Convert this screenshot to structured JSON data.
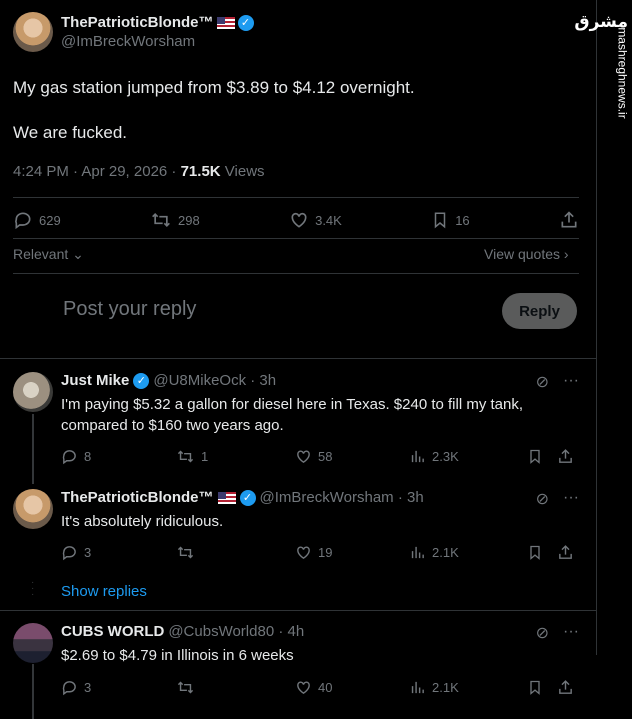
{
  "post": {
    "author_name": "ThePatrioticBlonde™",
    "author_handle": "@ImBreckWorsham",
    "text_line1": "My gas station jumped from $3.89 to $4.12 overnight.",
    "text_line2": "We are fucked.",
    "time": "4:24 PM · Apr 29, 2026 · ",
    "views_count": "71.5K",
    "views_label": " Views",
    "replies": "629",
    "reposts": "298",
    "likes": "3.4K",
    "bookmarks": "16"
  },
  "sort": {
    "label": "Relevant",
    "view_quotes": "View quotes"
  },
  "composer": {
    "placeholder": "Post your reply",
    "button": "Reply"
  },
  "replies": [
    {
      "name": "Just Mike",
      "handle": "@U8MikeOck · 3h",
      "text": "I'm paying $5.32 a gallon for diesel here in Texas. $240 to fill my tank, compared to $160 two years ago.",
      "replies": "8",
      "reposts": "1",
      "likes": "58",
      "views": "2.3K"
    },
    {
      "name": "ThePatrioticBlonde™",
      "handle": "@ImBreckWorsham · 3h",
      "text": "It's absolutely ridiculous.",
      "replies": "3",
      "reposts": "",
      "likes": "19",
      "views": "2.1K"
    },
    {
      "name": "CUBS WORLD",
      "handle": "@CubsWorld80 · 4h",
      "text": "$2.69 to $4.79 in Illinois in 6 weeks",
      "replies": "3",
      "reposts": "",
      "likes": "40",
      "views": "2.1K"
    }
  ],
  "show_replies": "Show replies",
  "watermark": {
    "logo": "مشرق",
    "site": "mashreghnews.ir"
  },
  "colors": {
    "accent": "#1d9bf0",
    "muted": "#71767b",
    "text": "#e7e9ea",
    "background": "#000000",
    "border": "#2f3336"
  }
}
